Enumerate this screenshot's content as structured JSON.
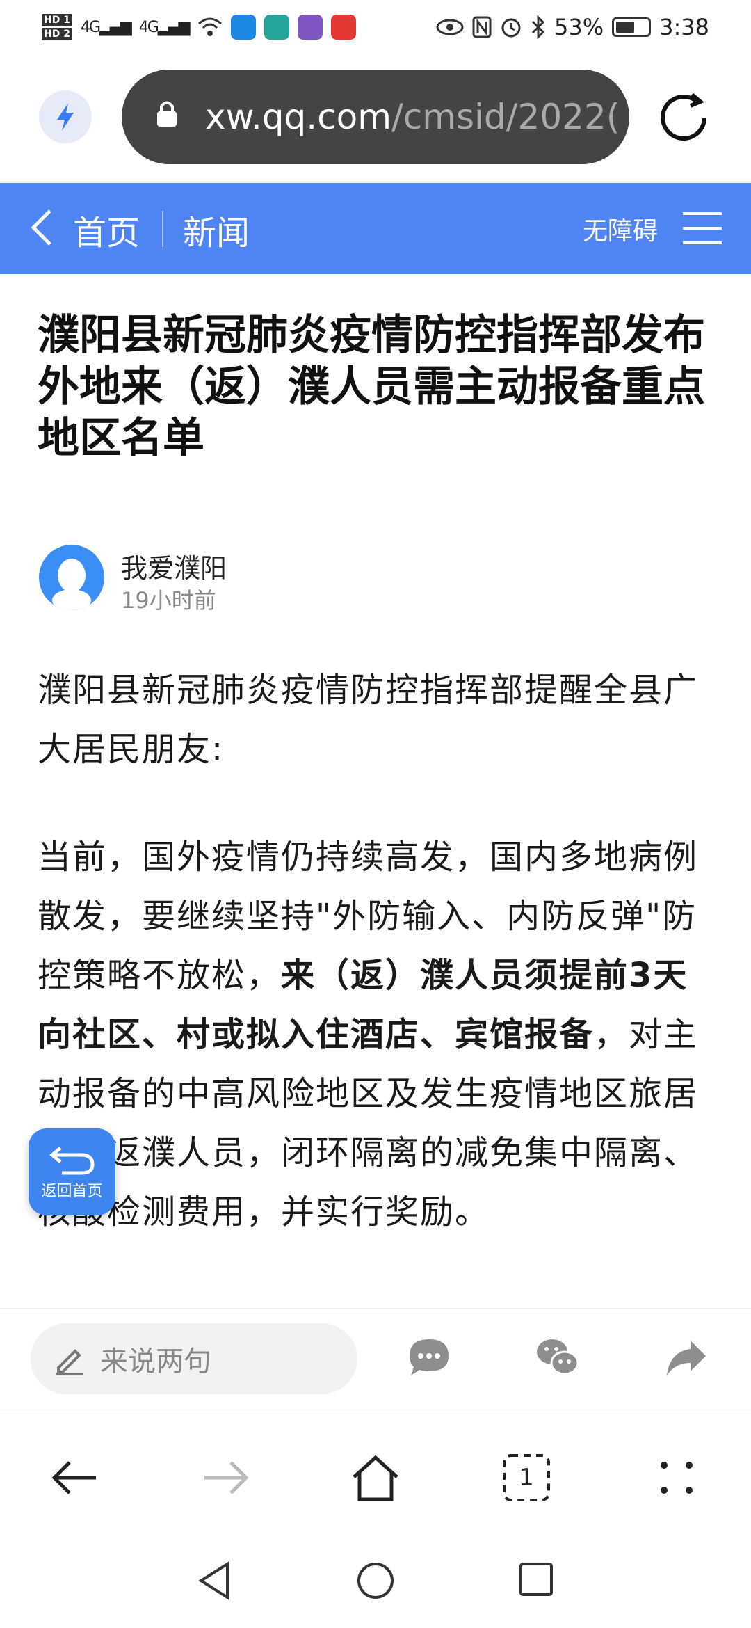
{
  "status": {
    "hd1": "HD 1",
    "hd2": "HD 2",
    "signal1": "4G",
    "signal2": "4G",
    "battery": "53%",
    "time": "3:38"
  },
  "browser": {
    "url_host": "xw.qq.com",
    "url_path": "/cmsid/2022("
  },
  "nav": {
    "home": "首页",
    "section": "新闻",
    "accessibility": "无障碍"
  },
  "article": {
    "title": "濮阳县新冠肺炎疫情防控指挥部发布外地来（返）濮人员需主动报备重点地区名单",
    "author": "我爱濮阳",
    "time": "19小时前",
    "p1": "濮阳县新冠肺炎疫情防控指挥部提醒全县广大居民朋友:",
    "p2_a": "当前，国外疫情仍持续高发，国内多地病例散发，要继续坚持\"外防输入、内防反弹\"防控策略不放松，",
    "p2_bold": "来（返）濮人员须提前3天向社区、村或拟入住酒店、宾馆报备",
    "p2_b": "，对主动报备的中高风险地区及发生疫情地区旅居史的返濮人员，闭环隔离的减免集中隔离、核酸检测费用，并实行奖励。"
  },
  "fab": {
    "label": "返回首页"
  },
  "comment": {
    "placeholder": "来说两句"
  },
  "toolbar": {
    "tabs_count": "1"
  },
  "colors": {
    "accent": "#4f84f3",
    "url_bg": "#444444"
  }
}
